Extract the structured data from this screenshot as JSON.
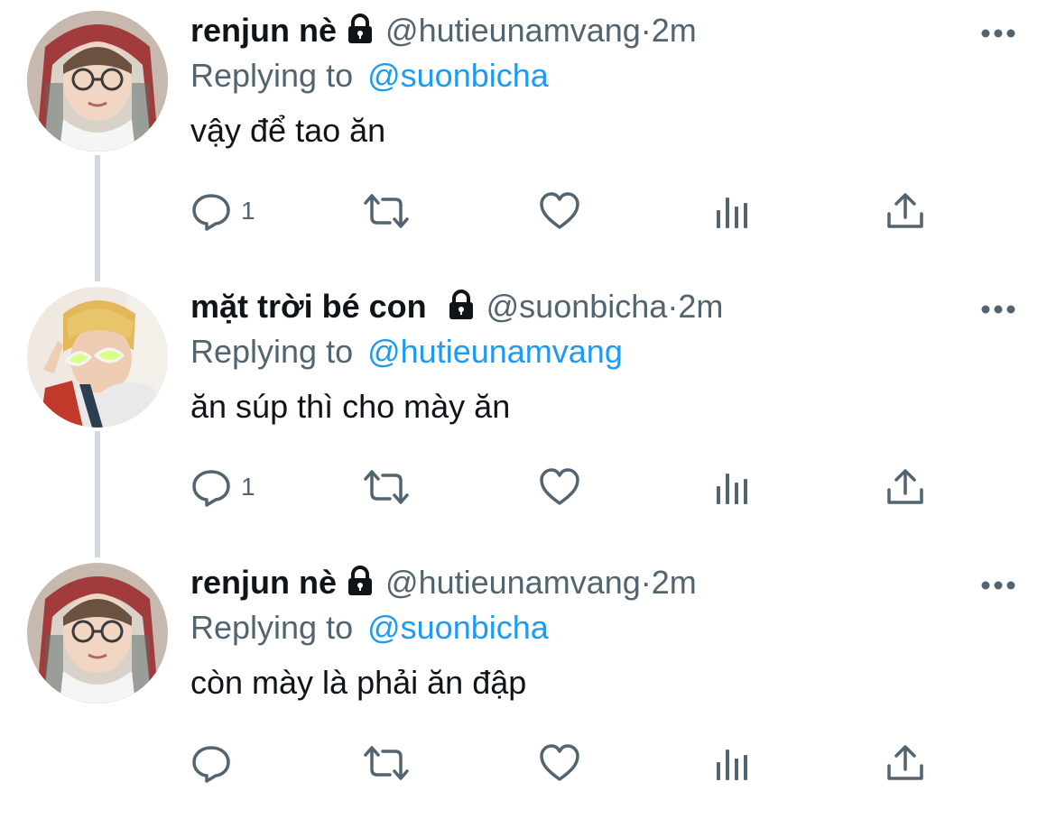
{
  "colors": {
    "text": "#0f1419",
    "secondary": "#536471",
    "link": "#1d9bf0",
    "thread_line": "#cfd9de"
  },
  "tweets": [
    {
      "name": "renjun nè",
      "handle": "@hutieunamvang",
      "separator": "·",
      "time": "2m",
      "replying_prefix": "Replying to",
      "replying_to": "@suonbicha",
      "text": "vậy để tao ăn",
      "reply_count": "1",
      "icons": [
        "lock-icon",
        "more-icon",
        "reply-icon",
        "retweet-icon",
        "like-icon",
        "analytics-icon",
        "share-icon"
      ]
    },
    {
      "name": "mặt trời bé con",
      "handle": "@suonbicha",
      "separator": "·",
      "time": "2m",
      "replying_prefix": "Replying to",
      "replying_to": "@hutieunamvang",
      "text": "ăn súp thì cho mày ăn",
      "reply_count": "1",
      "icons": [
        "lock-icon",
        "more-icon",
        "reply-icon",
        "retweet-icon",
        "like-icon",
        "analytics-icon",
        "share-icon"
      ]
    },
    {
      "name": "renjun nè",
      "handle": "@hutieunamvang",
      "separator": "·",
      "time": "2m",
      "replying_prefix": "Replying to",
      "replying_to": "@suonbicha",
      "text": "còn mày là phải ăn đập",
      "reply_count": "",
      "icons": [
        "lock-icon",
        "more-icon",
        "reply-icon",
        "retweet-icon",
        "like-icon",
        "analytics-icon",
        "share-icon"
      ]
    }
  ]
}
